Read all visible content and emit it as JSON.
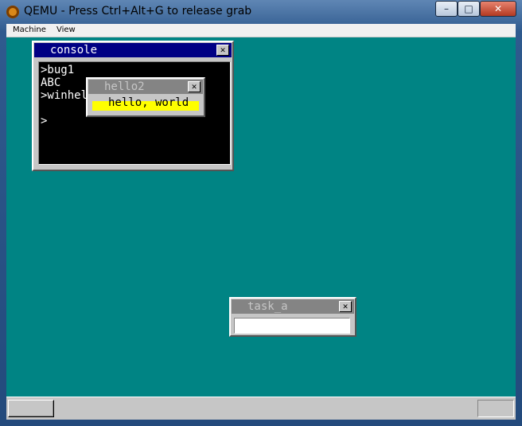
{
  "window": {
    "title": "QEMU - Press Ctrl+Alt+G to release grab",
    "minimize": "–",
    "maximize": "□",
    "close": "✕"
  },
  "menu": [
    "Machine",
    "View"
  ],
  "console": {
    "title": "console",
    "close": "✕",
    "lines": [
      ">bug1",
      "ABC",
      ">winhelo",
      "",
      ">"
    ]
  },
  "hello2": {
    "title": "hello2",
    "close": "✕",
    "message": "hello, world"
  },
  "task_a": {
    "title": "task_a",
    "close": "✕",
    "input": ""
  },
  "colors": {
    "desktop": "#008484",
    "active_title": "#000084",
    "inactive_title": "#848484",
    "highlight": "#ffff00"
  },
  "icons": [
    "qemu-icon",
    "minimize-icon",
    "maximize-icon",
    "close-icon"
  ]
}
